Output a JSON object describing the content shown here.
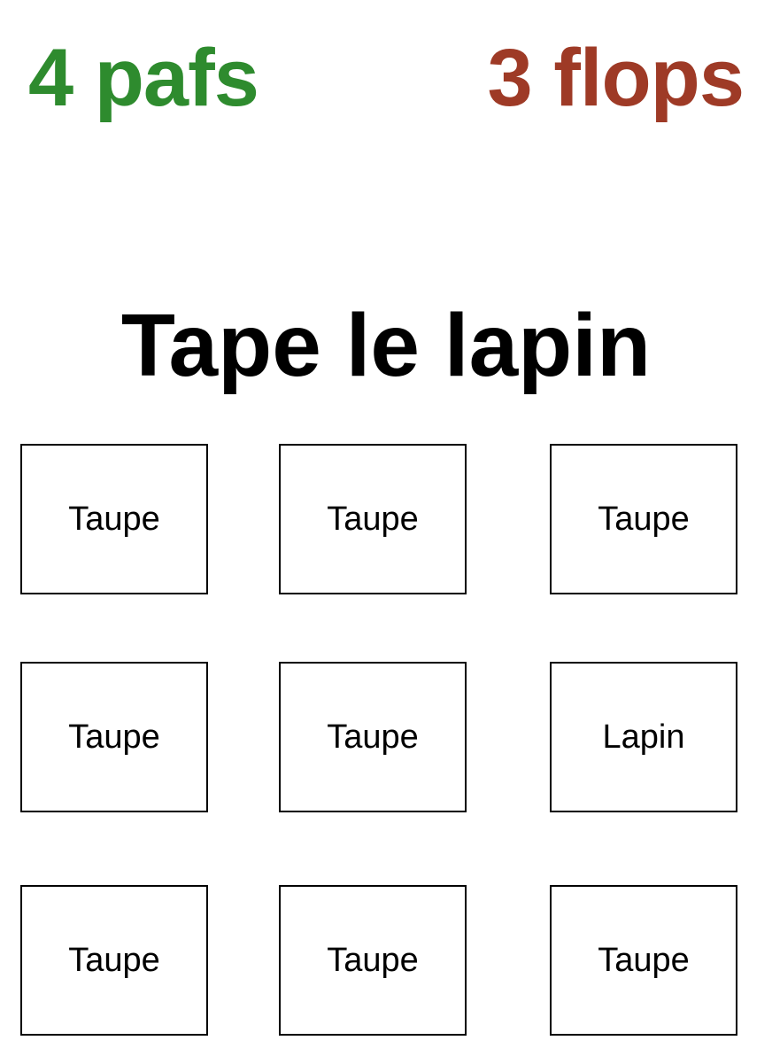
{
  "score": {
    "pafs": "4 pafs",
    "flops": "3 flops",
    "pafs_color": "#2e8b2e",
    "flops_color": "#9e3a26"
  },
  "title": "Tape le lapin",
  "grid": {
    "cells": [
      "Taupe",
      "Taupe",
      "Taupe",
      "Taupe",
      "Taupe",
      "Lapin",
      "Taupe",
      "Taupe",
      "Taupe"
    ]
  }
}
